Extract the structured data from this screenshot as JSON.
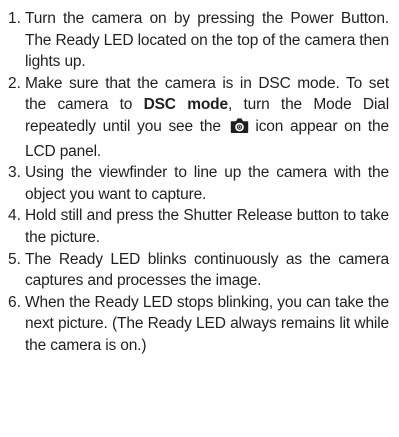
{
  "steps": [
    {
      "number": "1.",
      "text": "Turn the camera on by pressing the Power Button. The Ready LED located on the top of the camera then lights up."
    },
    {
      "number": "2.",
      "text_before": "Make sure that the camera is in DSC mode. To set the camera to ",
      "bold": "DSC mode",
      "text_middle": ", turn the Mode Dial repeatedly until you see the ",
      "icon": "camera-icon",
      "text_after": " icon  appear on the LCD panel."
    },
    {
      "number": "3.",
      "text": "Using the viewfinder to line up the camera with the object you want to capture."
    },
    {
      "number": "4.",
      "text": "Hold still and press the Shutter Release button to take the picture."
    },
    {
      "number": "5.",
      "text": "The Ready LED blinks continuously as the camera captures and processes the image."
    },
    {
      "number": "6.",
      "text": "When the Ready LED stops blinking, you can take the next picture. (The Ready LED always remains lit while the camera is on.)"
    }
  ]
}
